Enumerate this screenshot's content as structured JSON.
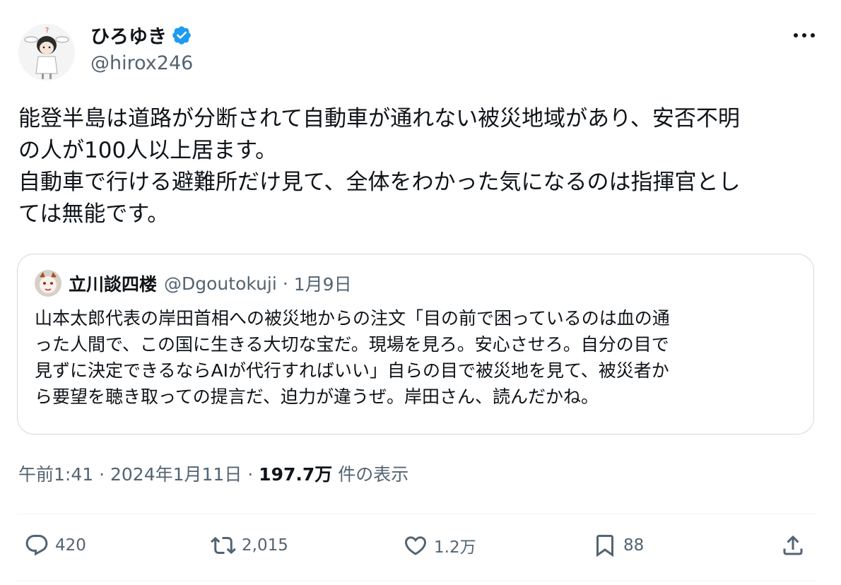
{
  "author": {
    "name": "ひろゆき",
    "handle": "@hirox246"
  },
  "tweet": {
    "text": "能登半島は道路が分断されて自動車が通れない被災地域があり、安否不明\nの人が100人以上居ます。\n自動車で行ける避難所だけ見て、全体をわかった気になるのは指揮官とし\nては無能です。"
  },
  "quote": {
    "name": "立川談四楼",
    "handle": "@Dgoutokuji",
    "separator": "·",
    "date": "1月9日",
    "text": "山本太郎代表の岸田首相への被災地からの注文「目の前で困っているのは血の通\nった人間で、この国に生きる大切な宝だ。現場を見ろ。安心させろ。自分の目で\n見ずに決定できるならAIが代行すればいい」自らの目で被災地を見て、被災者か\nら要望を聴き取っての提言だ、迫力が違うぜ。岸田さん、読んだかね。"
  },
  "meta": {
    "time": "午前1:41",
    "sep1": " · ",
    "date": "2024年1月11日",
    "sep2": " · ",
    "views": "197.7万",
    "views_label": " 件の表示"
  },
  "actions": {
    "replies": "420",
    "retweets": "2,015",
    "likes": "1.2万",
    "bookmarks": "88"
  },
  "colors": {
    "verified": "#1d9bf0",
    "secondary_text": "#536471",
    "border": "#cfd9de"
  },
  "icons": [
    "verified-badge-icon",
    "more-icon",
    "reply-icon",
    "retweet-icon",
    "like-icon",
    "bookmark-icon",
    "share-icon"
  ]
}
